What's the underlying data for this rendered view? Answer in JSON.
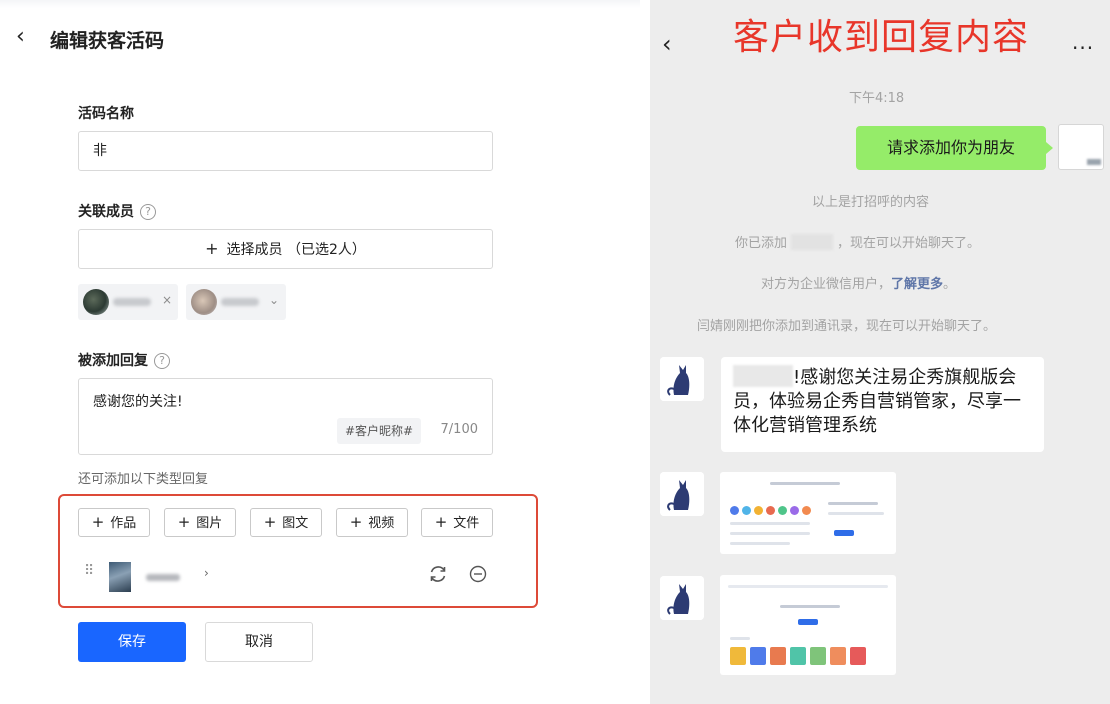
{
  "left_panel": {
    "back_arrow": "‹",
    "title": "编辑获客活码",
    "name_label": "活码名称",
    "name_value": "非",
    "members_label": "关联成员",
    "help_icon": "?",
    "select_members_plus": "+",
    "select_members_label": "选择成员 （已选2人）",
    "reply_label": "被添加回复",
    "reply_text": "感谢您的关注!",
    "nickname_button": "#客户昵称#",
    "char_counter": "7/100",
    "more_types_hint": "还可添加以下类型回复",
    "type_buttons": [
      {
        "plus": "+",
        "label": "作品"
      },
      {
        "plus": "+",
        "label": "图片"
      },
      {
        "plus": "+",
        "label": "图文"
      },
      {
        "plus": "+",
        "label": "视频"
      },
      {
        "plus": "+",
        "label": "文件"
      }
    ],
    "save_label": "保存",
    "cancel_label": "取消",
    "highlight_color": "#dd4a38",
    "primary_color": "#1966ff"
  },
  "right_panel": {
    "back_arrow": "‹",
    "more_label": "...",
    "annotation_title": "客户收到回复内容",
    "annotation_color": "#e8362a",
    "time_label": "下午4:18",
    "greeting_bubble": "请求添加你为朋友",
    "greeting_note": "以上是打招呼的内容",
    "added_prefix": "你已添加",
    "added_suffix": "，现在可以开始聊天了。",
    "enterprise_note": "对方为企业微信用户，",
    "learn_more": "了解更多",
    "learn_more_end": "。",
    "contact_note": "闫婧刚刚把你添加到通讯录，现在可以开始聊天了。",
    "welcome_message": "!感谢您关注易企秀旗舰版会员，体验易企秀自营销管家，尽享一体化营销管理系统",
    "bubble_color": "#95ec69"
  }
}
